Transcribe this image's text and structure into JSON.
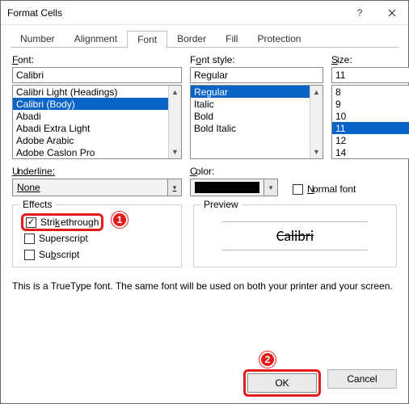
{
  "title": "Format Cells",
  "tabs": [
    "Number",
    "Alignment",
    "Font",
    "Border",
    "Fill",
    "Protection"
  ],
  "activeTab": "Font",
  "labels": {
    "font": "ont:",
    "fontU": "F",
    "style": "nt style:",
    "styleU": "F",
    "styleRest": "o",
    "size": "ize:",
    "sizeU": "S",
    "underline": "nderline:",
    "underlineU": "U",
    "color": "olor:",
    "colorU": "C",
    "normal": "ormal font",
    "normalU": "N",
    "effects": "Effects",
    "preview": "Preview",
    "strike": "ethrough",
    "strikeU": "Stri",
    "strikeK": "k",
    "super": "erscript",
    "superU": "Sup",
    "sub": "script",
    "subU": "Su",
    "subB": "b"
  },
  "font": {
    "value": "Calibri",
    "items": [
      "Calibri Light (Headings)",
      "Calibri (Body)",
      "Abadi",
      "Abadi Extra Light",
      "Adobe Arabic",
      "Adobe Caslon Pro"
    ],
    "selectedIndex": 1
  },
  "style": {
    "value": "Regular",
    "items": [
      "Regular",
      "Italic",
      "Bold",
      "Bold Italic"
    ],
    "selectedIndex": 0
  },
  "size": {
    "value": "11",
    "items": [
      "8",
      "9",
      "10",
      "11",
      "12",
      "14"
    ],
    "selectedIndex": 3
  },
  "underline": {
    "value": "None"
  },
  "color": {
    "value": "#000000"
  },
  "normalFont": false,
  "effects": {
    "strikethrough": true,
    "superscript": false,
    "subscript": false
  },
  "previewText": "Calibri",
  "note": "This is a TrueType font.  The same font will be used on both your printer and your screen.",
  "buttons": {
    "ok": "OK",
    "cancel": "Cancel"
  },
  "annotations": {
    "a1": "1",
    "a2": "2"
  }
}
